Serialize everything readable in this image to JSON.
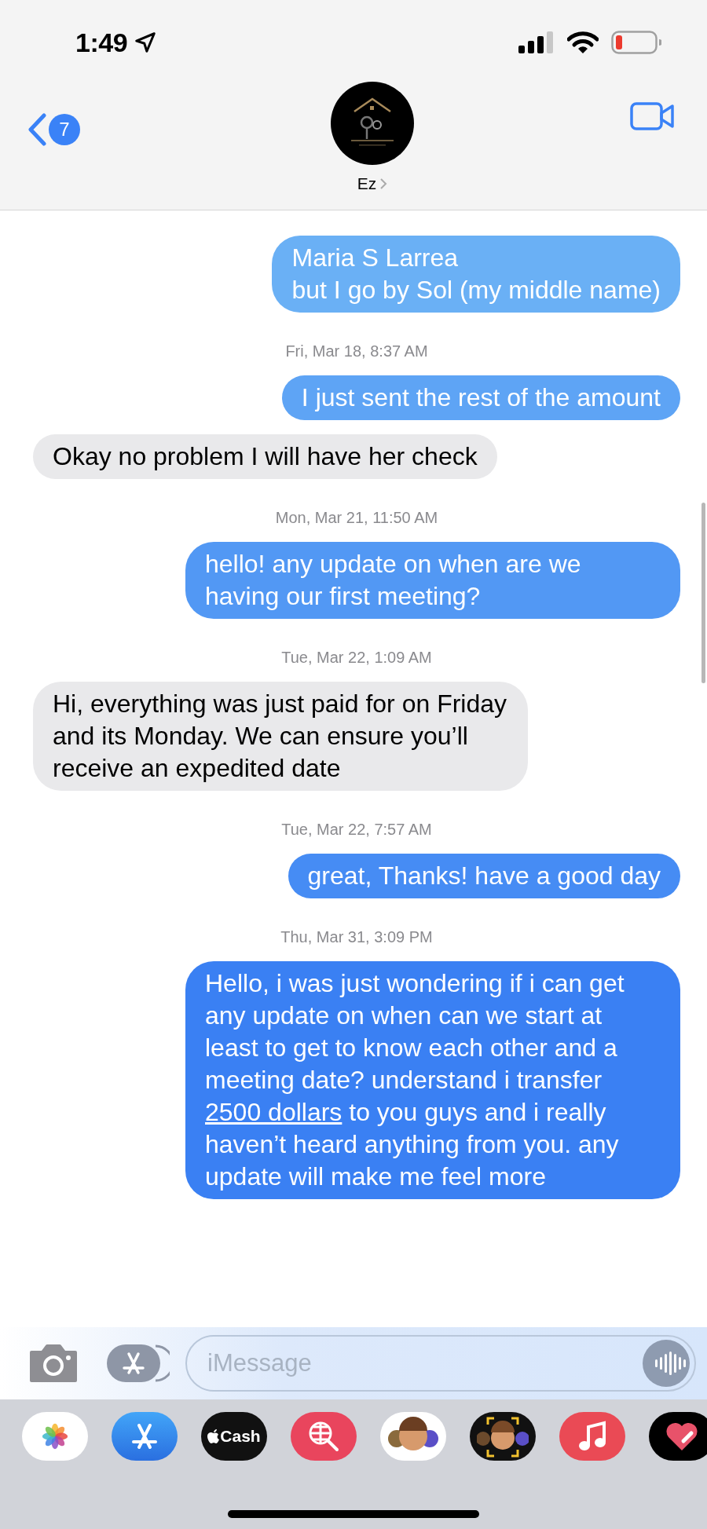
{
  "status_bar": {
    "time": "1:49"
  },
  "header": {
    "back_count": "7",
    "contact_name": "Ez"
  },
  "messages": [
    {
      "kind": "sent",
      "text": "Maria S Larrea\nbut I go by Sol (my middle name)"
    },
    {
      "kind": "timestamp",
      "text": "Fri, Mar 18, 8:37 AM"
    },
    {
      "kind": "sent",
      "text": "I just sent the rest of the amount"
    },
    {
      "kind": "received",
      "text": "Okay no problem I will have her check"
    },
    {
      "kind": "timestamp",
      "text": "Mon, Mar 21, 11:50 AM"
    },
    {
      "kind": "sent",
      "text": "hello! any update on when are we having our first meeting?"
    },
    {
      "kind": "timestamp",
      "text": "Tue, Mar 22, 1:09 AM"
    },
    {
      "kind": "received",
      "text": "Hi, everything was just paid for on Friday and its Monday. We can ensure you’ll receive an expedited date"
    },
    {
      "kind": "timestamp",
      "text": "Tue, Mar 22, 7:57 AM"
    },
    {
      "kind": "sent",
      "text": "great, Thanks! have a good day"
    },
    {
      "kind": "timestamp",
      "text": "Thu, Mar 31, 3:09 PM"
    },
    {
      "kind": "sent",
      "parts": [
        {
          "text": "Hello, i was just wondering if i can get any update on when can we start at least to get to know each other and a meeting date? understand i transfer ",
          "link": false
        },
        {
          "text": "2500 dollars",
          "link": true
        },
        {
          "text": " to you guys and i really haven’t heard anything from you. any update will make me feel more",
          "link": false
        }
      ]
    }
  ],
  "composer": {
    "placeholder": "iMessage"
  },
  "app_drawer": [
    {
      "kind": "photos"
    },
    {
      "kind": "appstore"
    },
    {
      "kind": "cash",
      "label": "Cash"
    },
    {
      "kind": "images"
    },
    {
      "kind": "stickers"
    },
    {
      "kind": "memoji"
    },
    {
      "kind": "music"
    },
    {
      "kind": "heart"
    }
  ]
}
